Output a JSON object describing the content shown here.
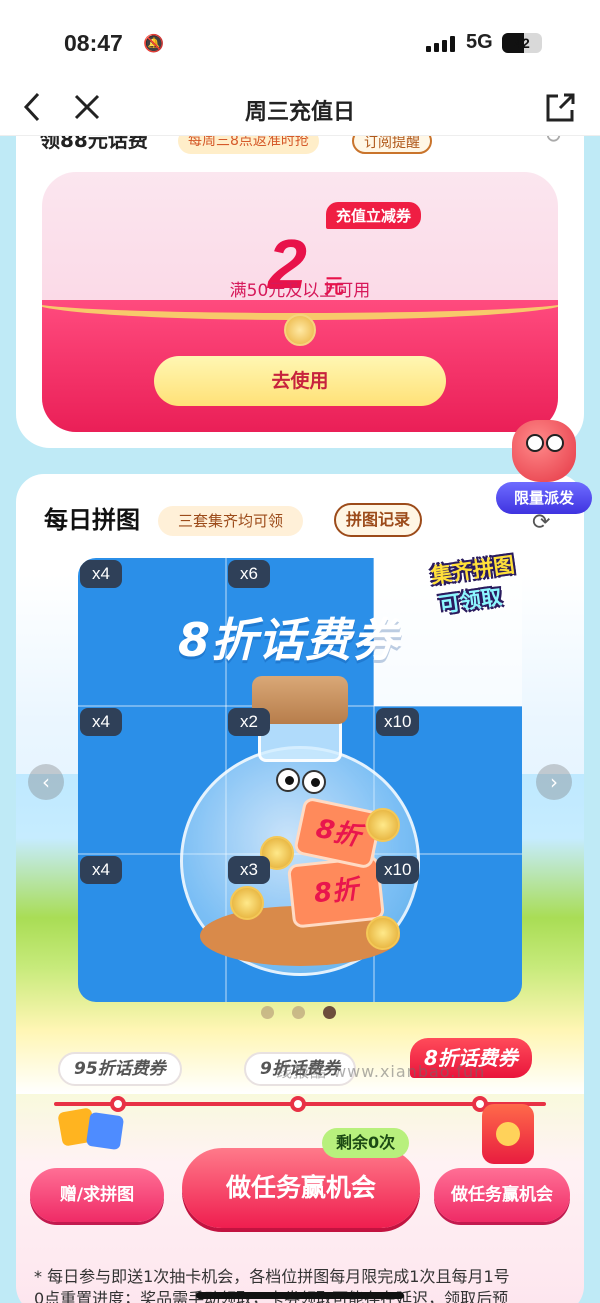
{
  "status_bar": {
    "time": "08:47",
    "network": "5G",
    "battery": "42"
  },
  "nav": {
    "title": "周三充值日",
    "back_icon": "chevron-left-icon",
    "close_icon": "close-icon",
    "share_icon": "share-icon"
  },
  "voucher_card": {
    "peek_title": "领88元话费",
    "peek_tag": "每周三8点返准时抢",
    "peek_button": "订阅提醒",
    "tag": "充值立减券",
    "amount": "2",
    "unit": "元",
    "condition": "满50元及以上可用",
    "use_button": "去使用"
  },
  "floating_badge": {
    "label": "限量派发"
  },
  "puzzle": {
    "title": "每日拼图",
    "tag": "三套集齐均可领",
    "record_button": "拼图记录",
    "headline": "8折话费券",
    "sticker_line1": "集齐拼图",
    "sticker_line2": "可领取",
    "ticket_label": "8折",
    "pieces": [
      {
        "count": "x4"
      },
      {
        "count": "x6"
      },
      {
        "count": ""
      },
      {
        "count": "x4"
      },
      {
        "count": "x2"
      },
      {
        "count": "x10"
      },
      {
        "count": "x4"
      },
      {
        "count": "x3"
      },
      {
        "count": "x10"
      }
    ],
    "active_page": 3,
    "page_count": 3
  },
  "tiers": [
    {
      "label": "95折话费券",
      "active": false
    },
    {
      "label": "9折话费券",
      "active": false
    },
    {
      "label": "8折话费券",
      "active": true
    }
  ],
  "actions": {
    "left_button": "赠/求拼图",
    "main_button": "做任务赢机会",
    "remaining": "剩余0次",
    "right_button": "做任务赢机会"
  },
  "notes": {
    "line1": "* 每日参与即送1次抽卡机会，各档位拼图每月限完成1次且每月1号",
    "line2": "0点重置进度；奖品需手动领取，卡券领取可能存在延迟，领取后预"
  },
  "watermark": "线报酷 www.xianbao.fun",
  "colors": {
    "brand_red": "#e8124a",
    "puzzle_blue": "#2b8fe8",
    "accent_purple": "#3f33e0"
  }
}
